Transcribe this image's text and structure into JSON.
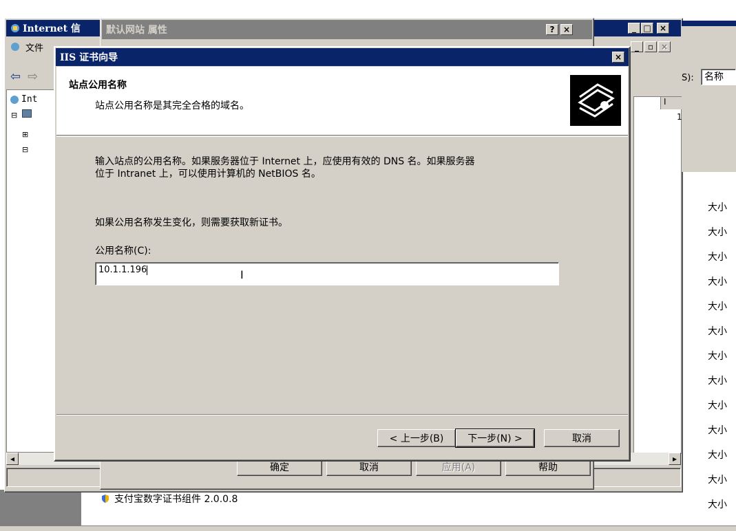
{
  "mmc": {
    "title": "Internet 信",
    "menu_file": "文件",
    "tree_root_label": "Int",
    "column_label": "S):",
    "column_value": "名称",
    "col_header_i": "I",
    "col_value_1": "1"
  },
  "site_props": {
    "title": "默认网站 属性",
    "help_btn": "?",
    "close_btn": "×",
    "ok": "确定",
    "cancel": "取消",
    "apply": "应用(A)",
    "help": "帮助"
  },
  "wizard": {
    "title": "IIS 证书向导",
    "close_btn": "×",
    "header_title": "站点公用名称",
    "header_subtitle": "站点公用名称是其完全合格的域名。",
    "paragraph_line1": "输入站点的公用名称。如果服务器位于 Internet 上，应使用有效的 DNS 名。如果服务器",
    "paragraph_line2": "位于 Intranet 上，可以使用计算机的 NetBIOS 名。",
    "change_note": "如果公用名称发生变化，则需要获取新证书。",
    "field_label": "公用名称(C):",
    "field_value": "10.1.1.196",
    "back": "< 上一步(B)",
    "next": "下一步(N) >",
    "cancel": "取消"
  },
  "background_list": {
    "size_label": "大小",
    "row_count": 13,
    "alipay_item": "支付宝数字证书组件 2.0.0.8"
  },
  "icons": {
    "wizard_banner": "certificate-icon",
    "mmc": "iis-icon"
  }
}
